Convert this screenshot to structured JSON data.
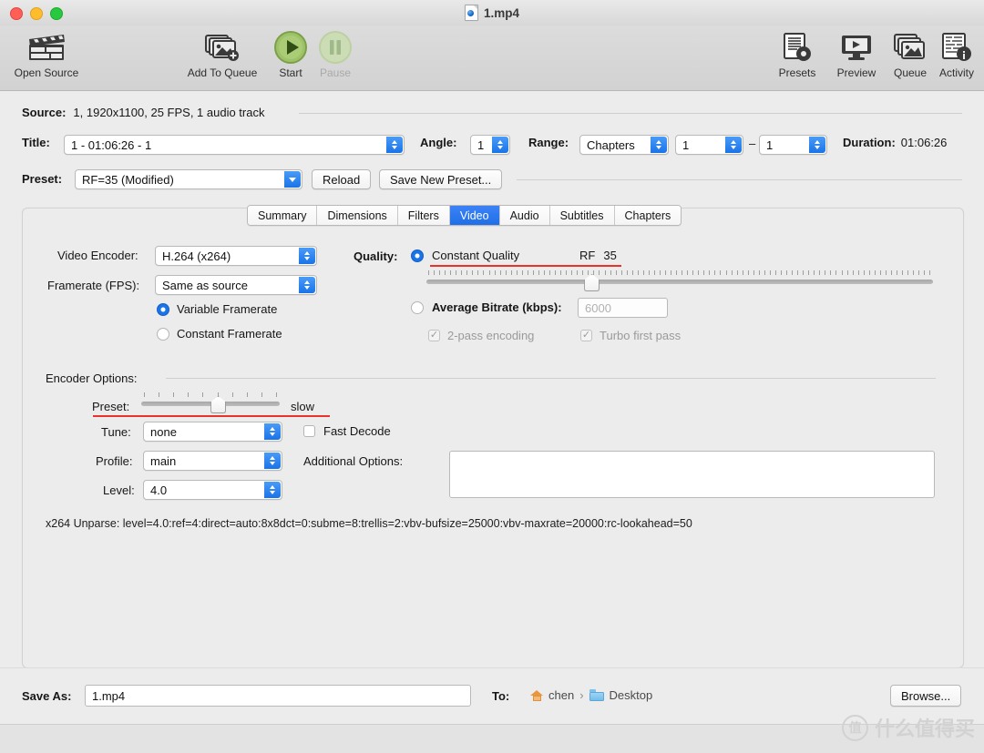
{
  "window": {
    "title": "1.mp4",
    "doc_icon": "quicktime-document-icon"
  },
  "toolbar": {
    "items": [
      {
        "label": "Open Source",
        "icon": "clapperboard-icon",
        "enabled": true
      },
      {
        "label": "Add To Queue",
        "icon": "add-to-queue-icon",
        "enabled": true
      },
      {
        "label": "Start",
        "icon": "play-circle-icon",
        "enabled": true
      },
      {
        "label": "Pause",
        "icon": "pause-circle-icon",
        "enabled": false
      },
      {
        "label": "Presets",
        "icon": "presets-icon",
        "enabled": true
      },
      {
        "label": "Preview",
        "icon": "preview-monitor-icon",
        "enabled": true
      },
      {
        "label": "Queue",
        "icon": "queue-stack-icon",
        "enabled": true
      },
      {
        "label": "Activity",
        "icon": "activity-log-icon",
        "enabled": true
      }
    ]
  },
  "source": {
    "label": "Source:",
    "value": "1, 1920x1100, 25 FPS, 1 audio track"
  },
  "title_row": {
    "label": "Title:",
    "value": "1 - 01:06:26 - 1",
    "angle_label": "Angle:",
    "angle_value": "1",
    "range_label": "Range:",
    "range_value": "Chapters",
    "range_start": "1",
    "range_dash": "–",
    "range_end": "1",
    "duration_label": "Duration:",
    "duration_value": "01:06:26"
  },
  "preset_row": {
    "label": "Preset:",
    "value": "RF=35 (Modified)",
    "reload_label": "Reload",
    "save_new_label": "Save New Preset..."
  },
  "tabs": [
    {
      "label": "Summary",
      "active": false
    },
    {
      "label": "Dimensions",
      "active": false
    },
    {
      "label": "Filters",
      "active": false
    },
    {
      "label": "Video",
      "active": true
    },
    {
      "label": "Audio",
      "active": false
    },
    {
      "label": "Subtitles",
      "active": false
    },
    {
      "label": "Chapters",
      "active": false
    }
  ],
  "video": {
    "encoder_label": "Video Encoder:",
    "encoder_value": "H.264 (x264)",
    "framerate_label": "Framerate (FPS):",
    "framerate_value": "Same as source",
    "variable_framerate_label": "Variable Framerate",
    "variable_framerate_selected": true,
    "constant_framerate_label": "Constant Framerate",
    "constant_framerate_selected": false,
    "quality_label": "Quality:",
    "constant_quality_label": "Constant Quality",
    "constant_quality_selected": true,
    "rf_label": "RF",
    "rf_value": "35",
    "quality_slider_percent": 32,
    "average_bitrate_label": "Average Bitrate (kbps):",
    "average_bitrate_selected": false,
    "average_bitrate_value": "6000",
    "two_pass_label": "2-pass encoding",
    "two_pass_checked": true,
    "two_pass_enabled": false,
    "turbo_label": "Turbo first pass",
    "turbo_checked": true,
    "turbo_enabled": false
  },
  "encoder_options": {
    "section_label": "Encoder Options:",
    "preset_label": "Preset:",
    "preset_value": "slow",
    "preset_slider_index": 6,
    "preset_slider_ticks": 10,
    "tune_label": "Tune:",
    "tune_value": "none",
    "fast_decode_label": "Fast Decode",
    "fast_decode_checked": false,
    "profile_label": "Profile:",
    "profile_value": "main",
    "level_label": "Level:",
    "level_value": "4.0",
    "additional_options_label": "Additional Options:",
    "additional_options_value": "",
    "unparse": "x264 Unparse: level=4.0:ref=4:direct=auto:8x8dct=0:subme=8:trellis=2:vbv-bufsize=25000:vbv-maxrate=20000:rc-lookahead=50"
  },
  "bottom": {
    "save_as_label": "Save As:",
    "save_as_value": "1.mp4",
    "to_label": "To:",
    "path_user": "chen",
    "path_separator": "›",
    "path_folder": "Desktop",
    "browse_label": "Browse..."
  },
  "watermark": {
    "badge": "值",
    "text": "什么值得买"
  },
  "colors": {
    "accent_blue": "#1a74e8",
    "tab_active": "#2f7df0",
    "annotation_red": "#e8322a",
    "window_bg": "#ececec"
  }
}
